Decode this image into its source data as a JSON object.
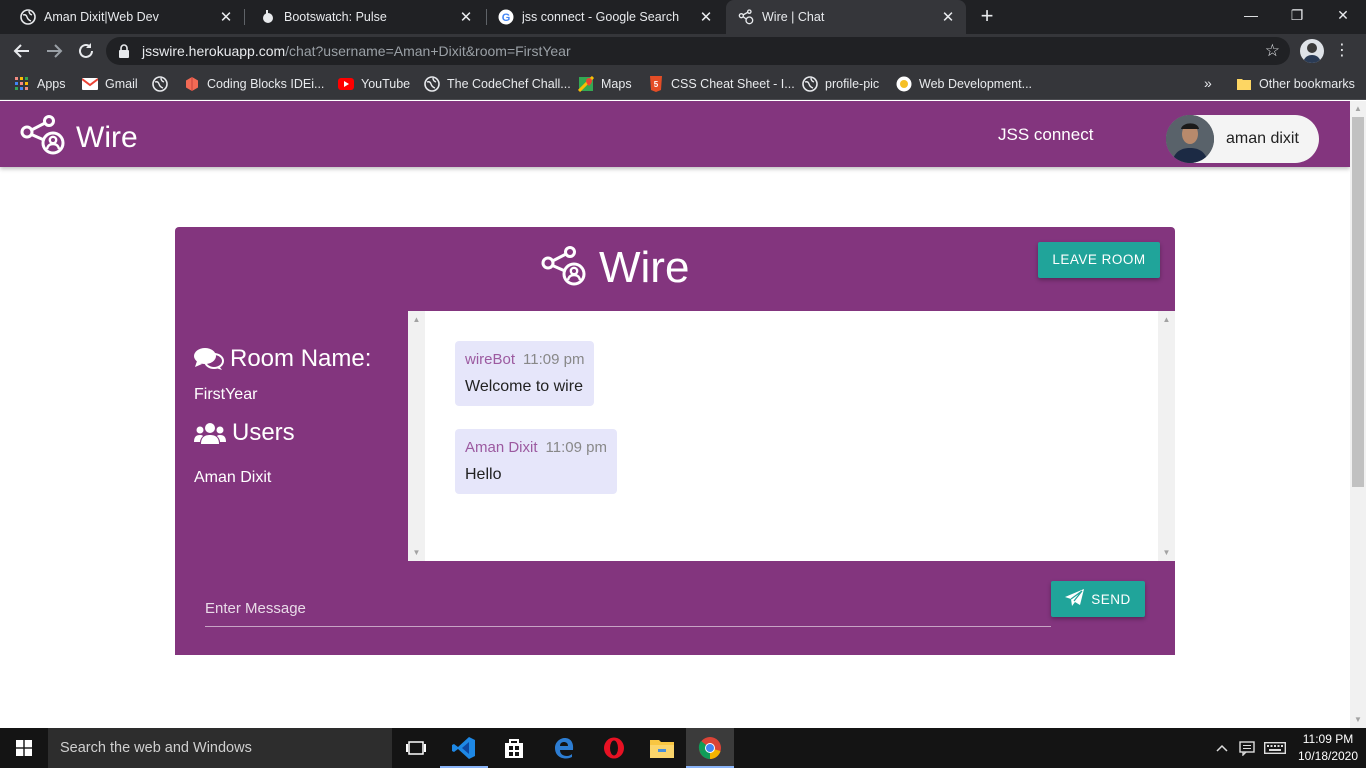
{
  "browser": {
    "tabs": [
      {
        "title": "Aman Dixit|Web Dev",
        "icon": "globe-icon"
      },
      {
        "title": "Bootswatch: Pulse",
        "icon": "bootswatch-icon"
      },
      {
        "title": "jss connect - Google Search",
        "icon": "google-icon"
      },
      {
        "title": "Wire | Chat",
        "icon": "wire-icon",
        "active": true
      }
    ],
    "new_tab": "+",
    "window_controls": {
      "minimize": "—",
      "restore": "❐",
      "close": "✕"
    },
    "url": {
      "host": "jsswire.herokuapp.com",
      "path": "/chat?username=Aman+Dixit&room=FirstYear"
    },
    "bookmarks": [
      {
        "label": "Apps",
        "icon": "apps-grid-icon"
      },
      {
        "label": "Gmail",
        "icon": "gmail-icon"
      },
      {
        "label": "",
        "icon": "globe-icon"
      },
      {
        "label": "Coding Blocks IDEi...",
        "icon": "coding-blocks-icon"
      },
      {
        "label": "YouTube",
        "icon": "youtube-icon"
      },
      {
        "label": "The CodeChef Chall...",
        "icon": "globe-icon"
      },
      {
        "label": "Maps",
        "icon": "maps-icon"
      },
      {
        "label": "CSS Cheat Sheet - I...",
        "icon": "html5-icon"
      },
      {
        "label": "profile-pic",
        "icon": "globe-icon"
      },
      {
        "label": "Web Development...",
        "icon": "web-dev-icon"
      }
    ],
    "bookmarks_overflow": "»",
    "other_bookmarks": "Other bookmarks"
  },
  "app": {
    "brand": "Wire",
    "nav_link": "JSS connect",
    "user_name": "aman dixit",
    "chat_title": "Wire",
    "leave_button": "LEAVE ROOM",
    "room_label": "Room Name:",
    "room_name": "FirstYear",
    "users_label": "Users",
    "users": [
      "Aman Dixit"
    ],
    "messages": [
      {
        "author": "wireBot",
        "time": "11:09 pm",
        "text": "Welcome to wire"
      },
      {
        "author": "Aman Dixit",
        "time": "11:09 pm",
        "text": "Hello"
      }
    ],
    "input_placeholder": "Enter Message",
    "send_button": "SEND"
  },
  "taskbar": {
    "search_placeholder": "Search the web and Windows",
    "apps": [
      "task-view-icon",
      "vscode-icon",
      "store-icon",
      "edge-icon",
      "opera-icon",
      "file-explorer-icon",
      "chrome-icon"
    ],
    "clock_time": "11:09 PM",
    "clock_date": "10/18/2020"
  },
  "colors": {
    "brand_purple": "#83357e",
    "teal_button": "#20a49a",
    "message_bubble": "#e6e6fa",
    "author_color": "#9c5aa0"
  }
}
